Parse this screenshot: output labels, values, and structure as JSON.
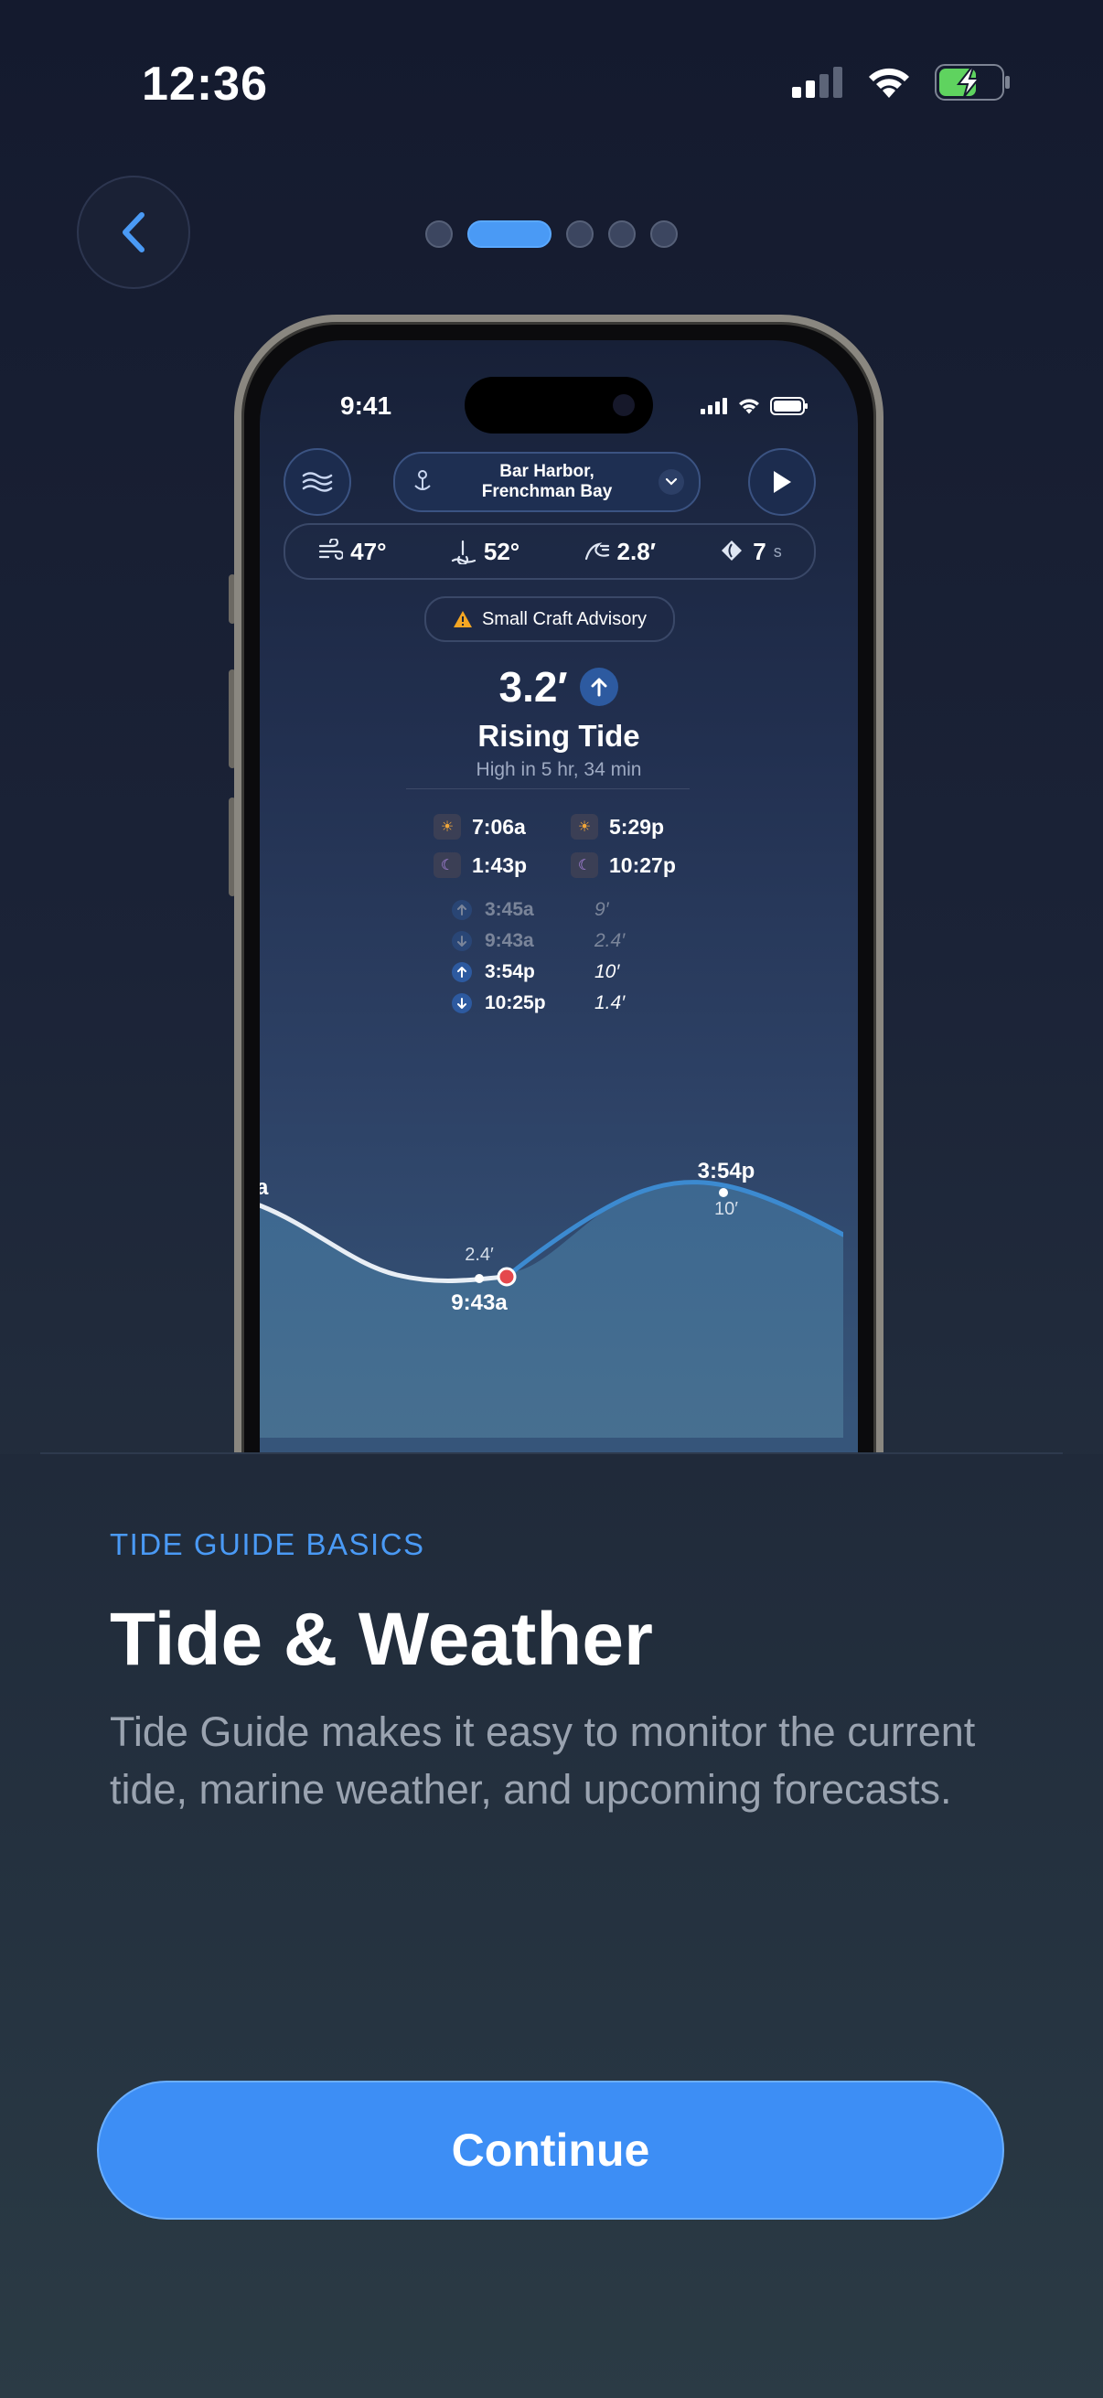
{
  "status_bar": {
    "time": "12:36"
  },
  "pager": {
    "count": 5,
    "active_index": 1
  },
  "mockup": {
    "status_time": "9:41",
    "location": {
      "line1": "Bar Harbor,",
      "line2": "Frenchman Bay"
    },
    "weather": [
      {
        "icon": "wind-icon",
        "value": "47°",
        "unit": ""
      },
      {
        "icon": "water-temp-icon",
        "value": "52°",
        "unit": ""
      },
      {
        "icon": "wave-icon",
        "value": "2.8′",
        "unit": ""
      },
      {
        "icon": "swell-period-icon",
        "value": "7",
        "unit": "s"
      }
    ],
    "advisory": "Small Craft Advisory",
    "current_height": "3.2′",
    "tide_state": "Rising Tide",
    "tide_sub": "High in 5 hr, 34 min",
    "sun_moon": [
      {
        "icon": "sunrise-icon",
        "time": "7:06a"
      },
      {
        "icon": "sunset-icon",
        "time": "5:29p"
      },
      {
        "icon": "moonrise-icon",
        "time": "1:43p"
      },
      {
        "icon": "moonset-icon",
        "time": "10:27p"
      }
    ],
    "tides": [
      {
        "dir": "up",
        "time": "3:45a",
        "height": "9′",
        "faded": true
      },
      {
        "dir": "down",
        "time": "9:43a",
        "height": "2.4′",
        "faded": true
      },
      {
        "dir": "up",
        "time": "3:54p",
        "height": "10′",
        "faded": false
      },
      {
        "dir": "down",
        "time": "10:25p",
        "height": "1.4′",
        "faded": false
      }
    ],
    "chart_labels": {
      "edge_label": "a",
      "low_height": "2.4′",
      "low_time": "9:43a",
      "high_time": "3:54p",
      "high_height": "10′"
    }
  },
  "onboarding": {
    "eyebrow": "TIDE GUIDE BASICS",
    "title": "Tide & Weather",
    "body": "Tide Guide makes it easy to monitor the current tide, marine weather, and upcoming forecasts.",
    "continue_label": "Continue"
  },
  "colors": {
    "accent": "#3d8ef5",
    "eyebrow": "#4a9af5",
    "body_text": "#9aa3b0",
    "chart_line": "#3c8ad0",
    "chart_past": "#e8eef5",
    "current_marker": "#e5484d"
  }
}
